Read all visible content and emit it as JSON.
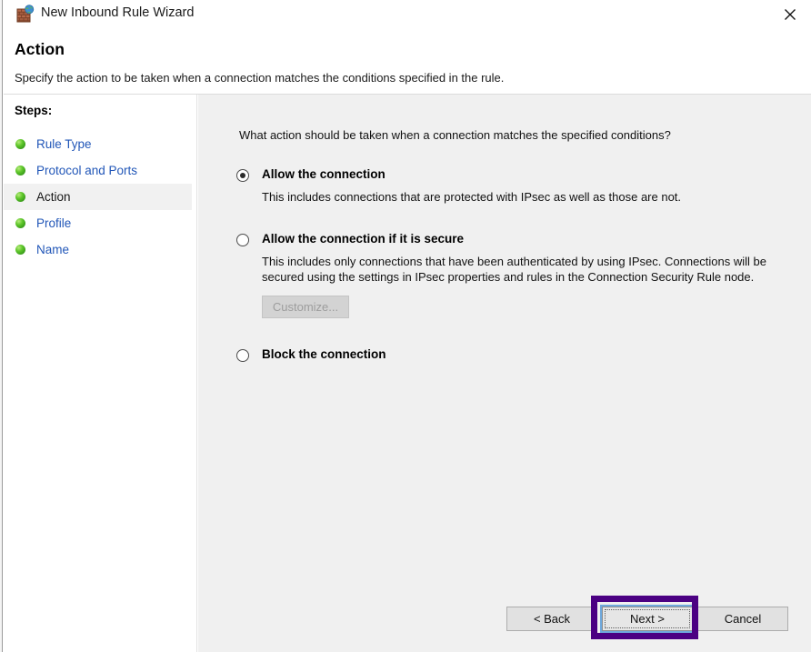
{
  "window": {
    "title": "New Inbound Rule Wizard",
    "icon": "firewall-globe-icon",
    "close_label": "✕"
  },
  "header": {
    "heading": "Action",
    "subheading": "Specify the action to be taken when a connection matches the conditions specified in the rule."
  },
  "sidebar": {
    "title": "Steps:",
    "items": [
      {
        "label": "Rule Type",
        "current": false
      },
      {
        "label": "Protocol and Ports",
        "current": false
      },
      {
        "label": "Action",
        "current": true
      },
      {
        "label": "Profile",
        "current": false
      },
      {
        "label": "Name",
        "current": false
      }
    ]
  },
  "main": {
    "question": "What action should be taken when a connection matches the specified conditions?",
    "options": [
      {
        "title": "Allow the connection",
        "description": "This includes connections that are protected with IPsec as well as those are not.",
        "selected": true
      },
      {
        "title": "Allow the connection if it is secure",
        "description": "This includes only connections that have been authenticated by using IPsec.  Connections will be secured using the settings in IPsec properties and rules in the Connection Security Rule node.",
        "selected": false,
        "button_label": "Customize...",
        "button_disabled": true
      },
      {
        "title": "Block the connection",
        "description": "",
        "selected": false
      }
    ]
  },
  "footer": {
    "back_label": "< Back",
    "next_label": "Next >",
    "cancel_label": "Cancel"
  },
  "annotation": {
    "target": "next-button",
    "highlight_color": "#4b0082"
  },
  "colors": {
    "link_blue": "#2257b8",
    "content_bg": "#f0f0f0",
    "sidebar_bg": "#ffffff",
    "current_step_bg": "#f1f1f1",
    "focus_ring": "#6fa8dc",
    "highlight_purple": "#4b0082"
  }
}
